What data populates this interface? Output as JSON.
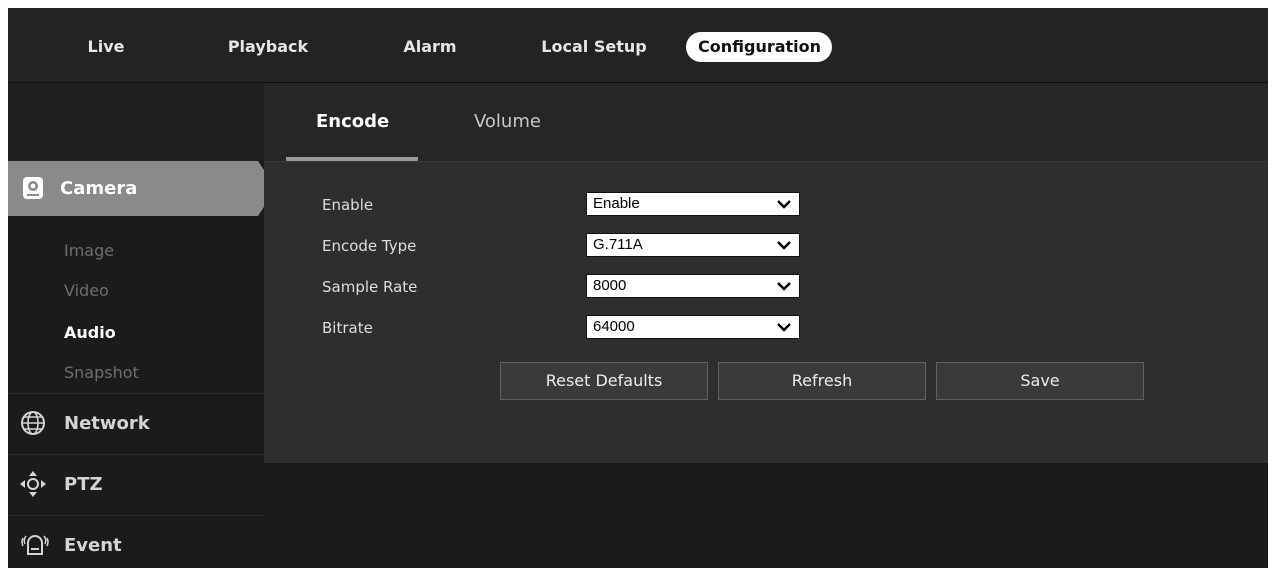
{
  "top_nav": {
    "items": [
      "Live",
      "Playback",
      "Alarm",
      "Local Setup",
      "Configuration"
    ],
    "active": "Configuration"
  },
  "sidebar": {
    "camera": {
      "label": "Camera",
      "icon": "camera-icon",
      "subitems": [
        "Image",
        "Video",
        "Audio",
        "Snapshot"
      ],
      "active_subitem": "Audio"
    },
    "network": {
      "label": "Network",
      "icon": "network-globe-icon"
    },
    "ptz": {
      "label": "PTZ",
      "icon": "ptz-arrows-icon"
    },
    "event": {
      "label": "Event",
      "icon": "alarm-bell-icon"
    }
  },
  "tabs": {
    "items": [
      "Encode",
      "Volume"
    ],
    "active": "Encode"
  },
  "form": {
    "fields": [
      {
        "label": "Enable",
        "value": "Enable"
      },
      {
        "label": "Encode Type",
        "value": "G.711A"
      },
      {
        "label": "Sample Rate",
        "value": "8000"
      },
      {
        "label": "Bitrate",
        "value": "64000"
      }
    ],
    "dropdown_icon": "chevron-down-icon"
  },
  "buttons": {
    "reset": "Reset Defaults",
    "refresh": "Refresh",
    "save": "Save"
  },
  "colors": {
    "background": "#1a1a1a",
    "active_section": "#8a8a8a",
    "active_nav_pill": "#ffffff",
    "panel": "#2e2e2e"
  }
}
